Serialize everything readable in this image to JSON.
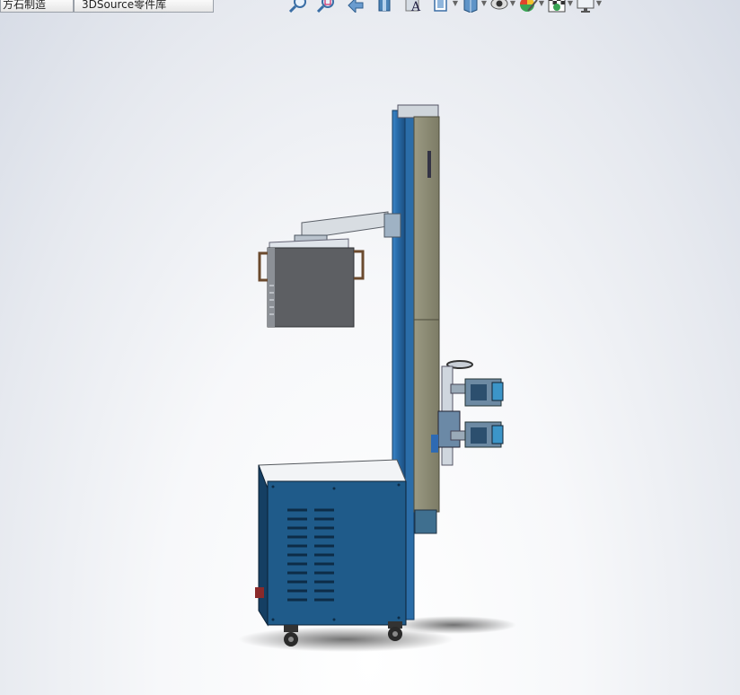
{
  "tabs": [
    {
      "label": "方石制造"
    },
    {
      "label": "3DSource零件库"
    }
  ],
  "toolbar": {
    "icons": [
      "zoom-to-fit-icon",
      "zoom-to-area-icon",
      "previous-view-icon",
      "section-view-icon",
      "dynamic-annotation-view-icon",
      "view-orientation-icon",
      "display-style-icon",
      "hide-show-items-icon",
      "edit-appearance-icon",
      "apply-scene-icon",
      "view-settings-icon"
    ]
  },
  "model": {
    "description": "3D CAD assembly: vertical column with arm-mounted panel, adjustable clamps and cabinet base on casters"
  },
  "colors": {
    "cabinet_blue": "#1f5b8a",
    "column_olive": "#8a8a72",
    "panel_gray": "#5d5f63",
    "background": "#e6e9ef"
  }
}
